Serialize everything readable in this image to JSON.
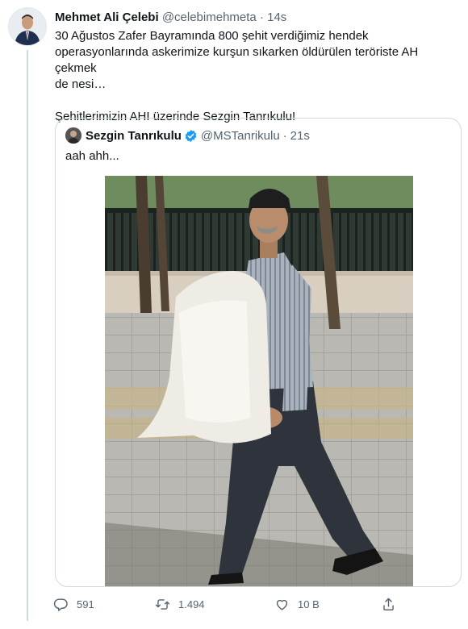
{
  "tweet": {
    "author_name": "Mehmet Ali Çelebi",
    "handle": "@celebimehmeta",
    "separator": "·",
    "time": "14s",
    "lines": [
      "30 Ağustos Zafer Bayramında 800 şehit verdiğimiz hendek",
      "operasyonlarında askerimize kurşun sıkarken öldürülen teröriste AH çekmek",
      "de nesi…"
    ],
    "line2": "Şehitlerimizin AHI üzerinde Sezgin Tanrıkulu!"
  },
  "quote": {
    "author_name": "Sezgin Tanrıkulu",
    "handle": "@MSTanrikulu",
    "separator": "·",
    "time": "21s",
    "text": "aah ahh..."
  },
  "actions": {
    "replies": "591",
    "retweets": "1.494",
    "likes": "10 B"
  },
  "colors": {
    "muted": "#536471",
    "border": "#cfd9de",
    "verified": "#1d9bf0"
  },
  "icons": [
    "reply-icon",
    "retweet-icon",
    "like-icon",
    "share-icon",
    "verified-badge-icon"
  ]
}
